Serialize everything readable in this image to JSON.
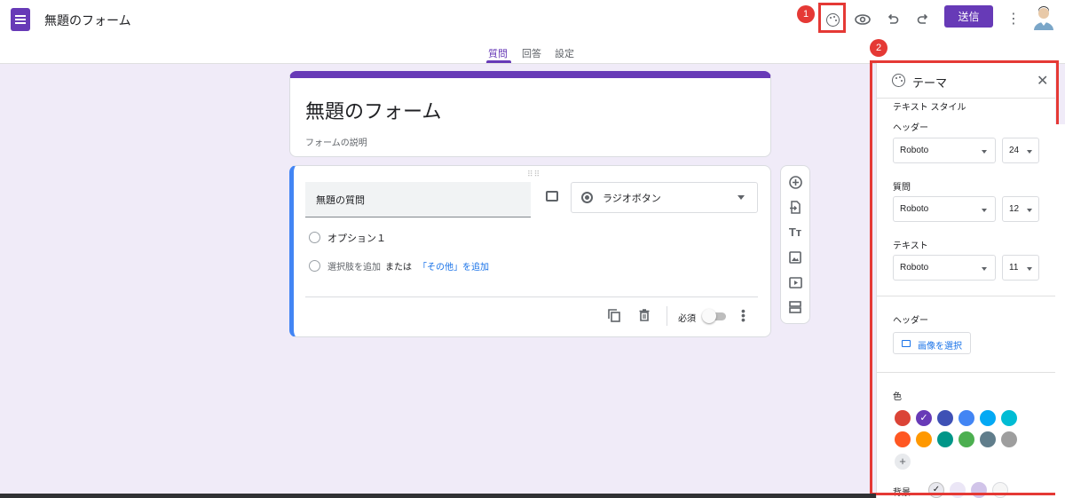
{
  "app": {
    "form_title": "無題のフォーム",
    "send_label": "送信",
    "brand_color": "#673ab7"
  },
  "markers": {
    "m1": "1",
    "m2": "2"
  },
  "tabs": [
    {
      "label": "質問",
      "active": true
    },
    {
      "label": "回答",
      "active": false
    },
    {
      "label": "設定",
      "active": false
    }
  ],
  "title_card": {
    "title": "無題のフォーム",
    "description_placeholder": "フォームの説明"
  },
  "question": {
    "title": "無題の質問",
    "type_label": "ラジオボタン",
    "option1": "オプション１",
    "add_option": "選択肢を追加",
    "or_label": "または",
    "add_other": "「その他」を追加",
    "required_label": "必須"
  },
  "theme_panel": {
    "title": "テーマ",
    "text_style_heading": "テキスト スタイル",
    "header_label": "ヘッダー",
    "header_font": "Roboto",
    "header_size": "24",
    "question_label": "質問",
    "question_font": "Roboto",
    "question_size": "12",
    "text_label": "テキスト",
    "text_font": "Roboto",
    "text_size": "11",
    "header_image_label": "ヘッダー",
    "choose_image": "画像を選択",
    "color_label": "色",
    "colors": [
      "#db4437",
      "#673ab7",
      "#3f51b5",
      "#4285f4",
      "#03a9f4",
      "#00bcd4",
      "#ff5722",
      "#ff9800",
      "#009688",
      "#4caf50",
      "#607d8b",
      "#9e9e9e"
    ],
    "selected_color": "#673ab7",
    "add_color": "+",
    "background_label": "背景",
    "background_colors": [
      "#e8e8ee",
      "#ebe6f6",
      "#d1c4e9",
      "#f6f6f6"
    ]
  },
  "icons": [
    "palette-icon",
    "eye-icon",
    "undo-icon",
    "redo-icon",
    "more-vert-icon",
    "avatar",
    "image-icon",
    "copy-icon",
    "delete-icon",
    "add-circle-icon",
    "import-icon",
    "title-icon",
    "image-add-icon",
    "video-icon",
    "section-icon",
    "close-icon"
  ]
}
